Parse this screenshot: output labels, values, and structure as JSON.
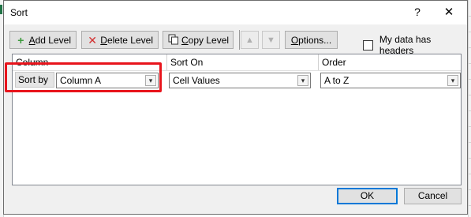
{
  "dialog": {
    "title": "Sort",
    "help": "?",
    "close": "✕"
  },
  "toolbar": {
    "add_level_pre": "",
    "add_level_u": "A",
    "add_level_post": "dd Level",
    "delete_level_u": "D",
    "delete_level_post": "elete Level",
    "copy_level_u": "C",
    "copy_level_post": "opy Level",
    "move_up": "▲",
    "move_down": "▼",
    "options_u": "O",
    "options_post": "ptions...",
    "headers_pre": "My data has ",
    "headers_u": "h",
    "headers_post": "eaders"
  },
  "columns": {
    "column": "Column",
    "sort_on": "Sort On",
    "order": "Order"
  },
  "rows": [
    {
      "label": "Sort by",
      "column": "Column A",
      "sort_on": "Cell Values",
      "order": "A to Z"
    }
  ],
  "buttons": {
    "ok": "OK",
    "cancel": "Cancel"
  },
  "colors": {
    "highlight": "#e8141c",
    "accent": "#0078d7"
  },
  "icons": [
    "add-level-icon",
    "delete-level-icon",
    "copy-level-icon",
    "move-up-icon",
    "move-down-icon",
    "dropdown-arrow-icon"
  ]
}
